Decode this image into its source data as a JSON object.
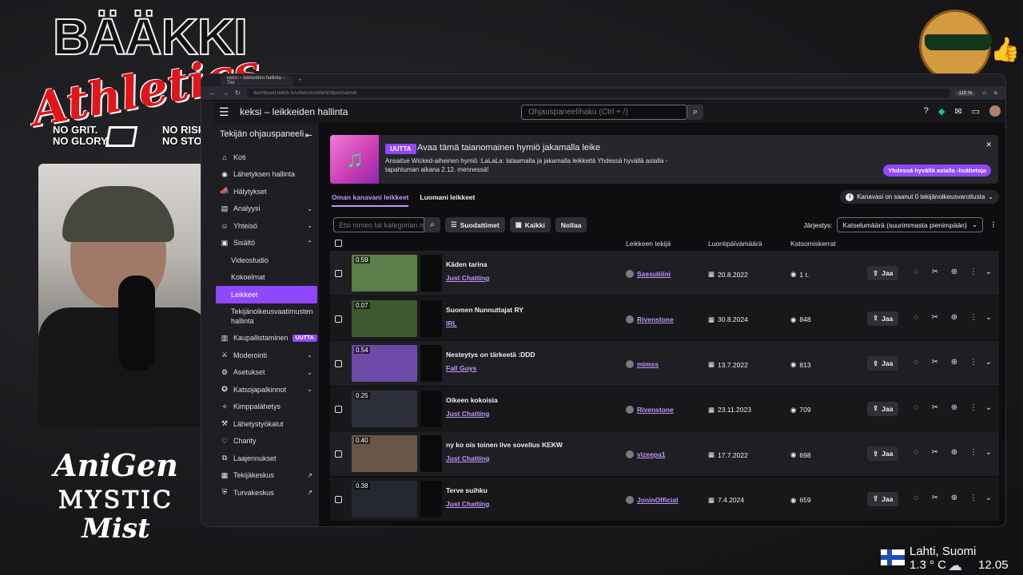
{
  "overlay": {
    "brand_top": "BÄÄKKI",
    "brand_script": "Athletics",
    "slogan_left": "NO GRIT.\nNO GLORY.",
    "slogan_right": "NO RISK.\nNO STORY.",
    "anigen": "AniGen",
    "mystic": "MYSTIC",
    "mist": "Mist",
    "weather": {
      "city": "Lahti, Suomi",
      "temp": "1.3 ° C",
      "time": "12.05"
    }
  },
  "browser": {
    "tab_title": "keksi – leikkeiden hallinta – Twi",
    "url": "dashboard.twitch.tv/u/keksi/content/clips/channel",
    "zoom": "110 %"
  },
  "topnav": {
    "title": "keksi – leikkeiden hallinta",
    "search_placeholder": "Ohjauspaneelihaku (Ctrl + /)"
  },
  "sidebar": {
    "header": "Tekijän ohjauspaneeli",
    "items": [
      {
        "label": "Koti",
        "icon": "home-icon"
      },
      {
        "label": "Lähetyksen hallinta",
        "icon": "broadcast-icon"
      },
      {
        "label": "Hälytykset",
        "icon": "alert-icon"
      },
      {
        "label": "Analyysi",
        "icon": "analytics-icon"
      },
      {
        "label": "Yhteisö",
        "icon": "community-icon"
      },
      {
        "label": "Sisältö",
        "icon": "content-icon"
      },
      {
        "label": "Videostudio"
      },
      {
        "label": "Kokoelmat"
      },
      {
        "label": "Leikkeet"
      },
      {
        "label": "Tekijänoikeusvaatimusten hallinta"
      },
      {
        "label": "Kaupallistaminen",
        "icon": "monetization-icon",
        "badge": "UUTTA"
      },
      {
        "label": "Moderointi",
        "icon": "moderation-icon"
      },
      {
        "label": "Asetukset",
        "icon": "settings-icon"
      },
      {
        "label": "Katsojapalkinnot",
        "icon": "rewards-icon"
      },
      {
        "label": "Kimppalähetys",
        "icon": "guest-star-icon"
      },
      {
        "label": "Lähetystyökalut",
        "icon": "tools-icon"
      },
      {
        "label": "Charity",
        "icon": "charity-icon"
      },
      {
        "label": "Laajennukset",
        "icon": "extensions-icon"
      },
      {
        "label": "Tekijäkeskus",
        "icon": "creator-camp-icon"
      },
      {
        "label": "Turvakeskus",
        "icon": "safety-icon"
      }
    ]
  },
  "banner": {
    "tag": "UUTTA",
    "headline": "Avaa tämä taianomainen hymiö jakamalla leike",
    "body": "Ansaitse Wicked-aiheinen hymiö :LaLaLa: lataamalla ja jakamalla leikkeitä Yhdessä hyvällä asialla -tapahtuman aikana 2.12. mennessä!",
    "cta": "Yhdessä hyvällä asialla -lisätietoja"
  },
  "tabs": {
    "own": "Oman kanavani leikkeet",
    "created": "Luomani leikkeet"
  },
  "copyright_notice": "Kanavasi on saanut 0 tekijänoikeusvaroitusta",
  "filters": {
    "search_placeholder": "Etsi nimen tai kategorian mukaan",
    "filters_btn": "Suodattimet",
    "all_btn": "Kaikki",
    "reset_btn": "Nollaa",
    "sort_label": "Järjestys:",
    "sort_value": "Katselumäärä (suurimmasta pienimpään)"
  },
  "table": {
    "headers": {
      "author": "Leikkeen tekijä",
      "date": "Luontipäivämäärä",
      "views": "Katsomiskerrat"
    },
    "share_label": "Jaa",
    "rows": [
      {
        "duration": "0.59",
        "title": "Käden tarina",
        "category": "Just Chatting",
        "author": "Sassuliiini",
        "date": "20.8.2022",
        "views": "1 t.",
        "thumb": "#5b7e4a"
      },
      {
        "duration": "0.07",
        "title": "Suomen Nunnuttajat RY",
        "category": "IRL",
        "author": "Rivenstone",
        "date": "30.8.2024",
        "views": "848",
        "thumb": "#3d5a2f"
      },
      {
        "duration": "0.54",
        "title": "Nesteytys on tärkeetä :DDD",
        "category": "Fall Guys",
        "author": "mimss",
        "date": "13.7.2022",
        "views": "813",
        "thumb": "#6e4aa8"
      },
      {
        "duration": "0.25",
        "title": "Oikeen kokoisia",
        "category": "Just Chatting",
        "author": "Rivenstone",
        "date": "23.11.2023",
        "views": "709",
        "thumb": "#2d2f3a"
      },
      {
        "duration": "0.40",
        "title": "ny ko ois toinen live sovellus KEKW",
        "category": "Just Chatting",
        "author": "vizeepa1",
        "date": "17.7.2022",
        "views": "698",
        "thumb": "#6a5648"
      },
      {
        "duration": "0.38",
        "title": "Terve suihku",
        "category": "Just Chatting",
        "author": "JoninOfficial",
        "date": "7.4.2024",
        "views": "659",
        "thumb": "#242830"
      }
    ]
  }
}
